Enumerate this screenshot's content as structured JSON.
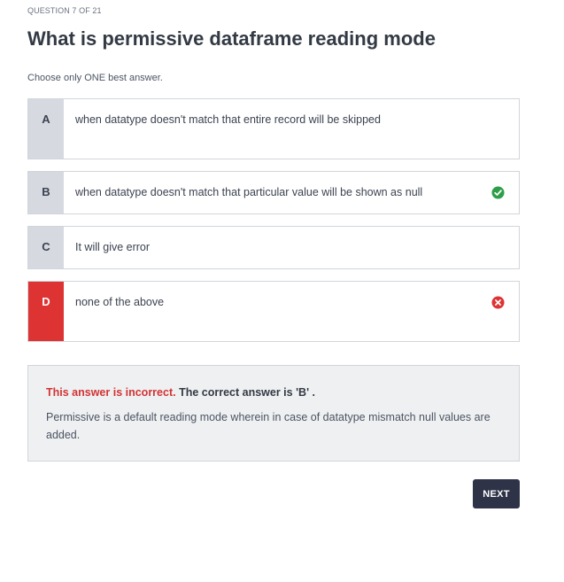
{
  "header": {
    "question_count": "QUESTION 7 OF 21",
    "title": "What is permissive dataframe reading mode",
    "instruction": "Choose only ONE best answer."
  },
  "options": [
    {
      "letter": "A",
      "text": "when datatype doesn't match that entire record will be skipped",
      "state": "neutral"
    },
    {
      "letter": "B",
      "text": "when datatype doesn't match that particular value will be shown as null",
      "state": "correct",
      "icon": "check-circle-icon"
    },
    {
      "letter": "C",
      "text": "It will give error",
      "state": "neutral"
    },
    {
      "letter": "D",
      "text": "none of the above",
      "state": "selected-incorrect",
      "icon": "x-circle-icon"
    }
  ],
  "feedback": {
    "incorrect_label": "This answer is incorrect.",
    "correct_answer_text": " The correct answer is 'B' .",
    "explanation": "Permissive is a default reading mode wherein in case of datatype mismatch null values are added."
  },
  "actions": {
    "next_label": "NEXT"
  },
  "colors": {
    "correct": "#2e9e48",
    "incorrect": "#dd3333",
    "letter_bg": "#d6d9e0",
    "button_bg": "#2e3347"
  }
}
